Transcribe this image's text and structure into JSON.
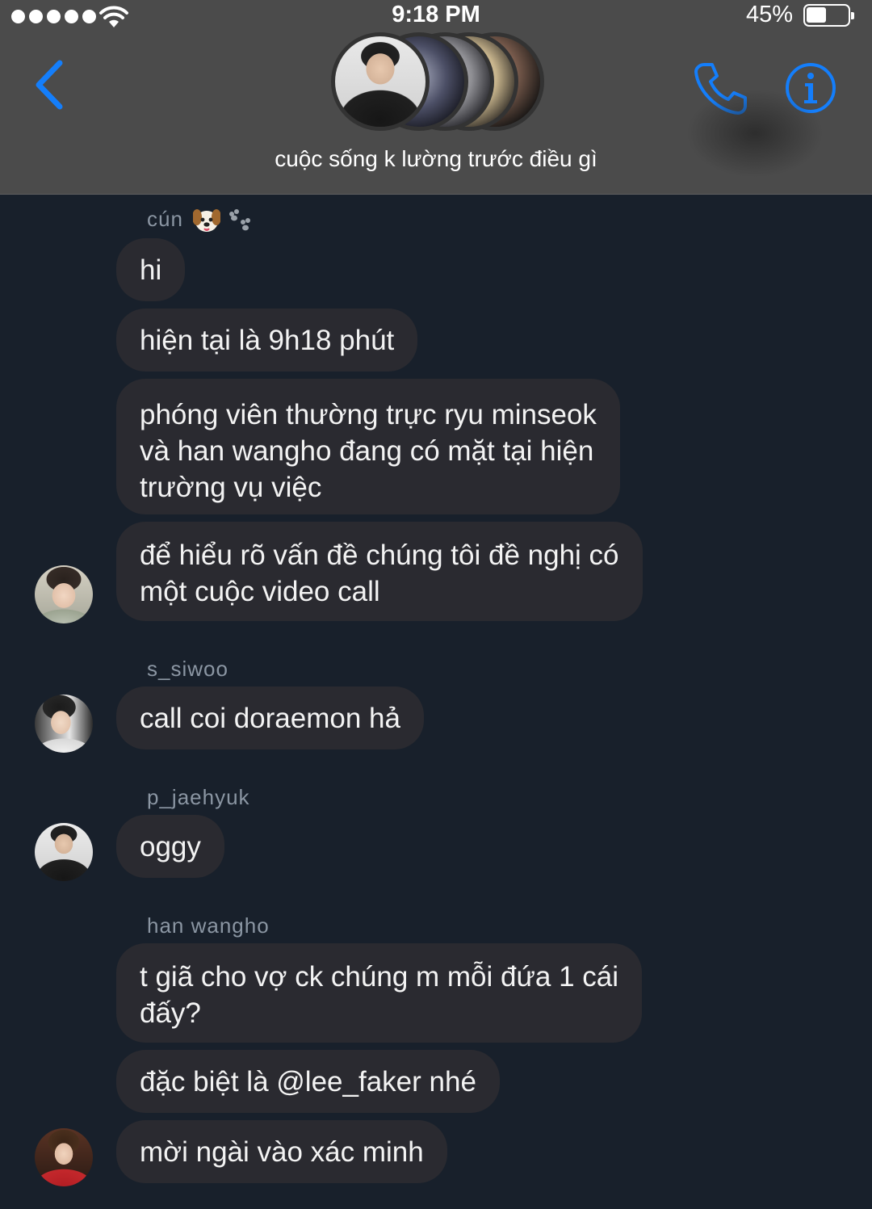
{
  "status_bar": {
    "time": "9:18 PM",
    "battery": "45%",
    "battery_level": 0.45,
    "signal_bars": 5,
    "icons": [
      "signal-dots-icon",
      "wifi-icon",
      "battery-icon"
    ]
  },
  "header": {
    "title": "cuộc sống k lường trước điều gì",
    "icons": [
      "back-chevron-icon",
      "phone-icon",
      "info-icon"
    ],
    "accent_color": "#147efb"
  },
  "messages": [
    {
      "sender": "cún",
      "sender_emoji": [
        "dog-face-icon",
        "paw-prints-icon"
      ],
      "bubbles": [
        "hi",
        "hiện tại là 9h18 phút",
        [
          "phóng viên thường trực ryu minseok",
          "và han wangho đang có mặt tại hiện",
          "trường vụ việc"
        ],
        [
          "để hiểu rõ vấn đề chúng tôi đề nghị có",
          "một cuộc video call"
        ]
      ]
    },
    {
      "sender": "s_siwoo",
      "bubbles": [
        "call coi doraemon hả"
      ]
    },
    {
      "sender": "p_jaehyuk",
      "bubbles": [
        "oggy"
      ]
    },
    {
      "sender": "han wangho",
      "bubbles": [
        [
          "t giã cho vợ ck chúng m mỗi đứa 1 cái",
          "đấy?"
        ],
        "đặc biệt là @lee_faker nhé",
        "mời ngài vào xác minh"
      ]
    }
  ],
  "colors": {
    "header_bg": "#4b4b4b",
    "chat_bg": "#18202b",
    "bubble_bg": "#2a2a30",
    "sender_text": "#8b96a3"
  }
}
